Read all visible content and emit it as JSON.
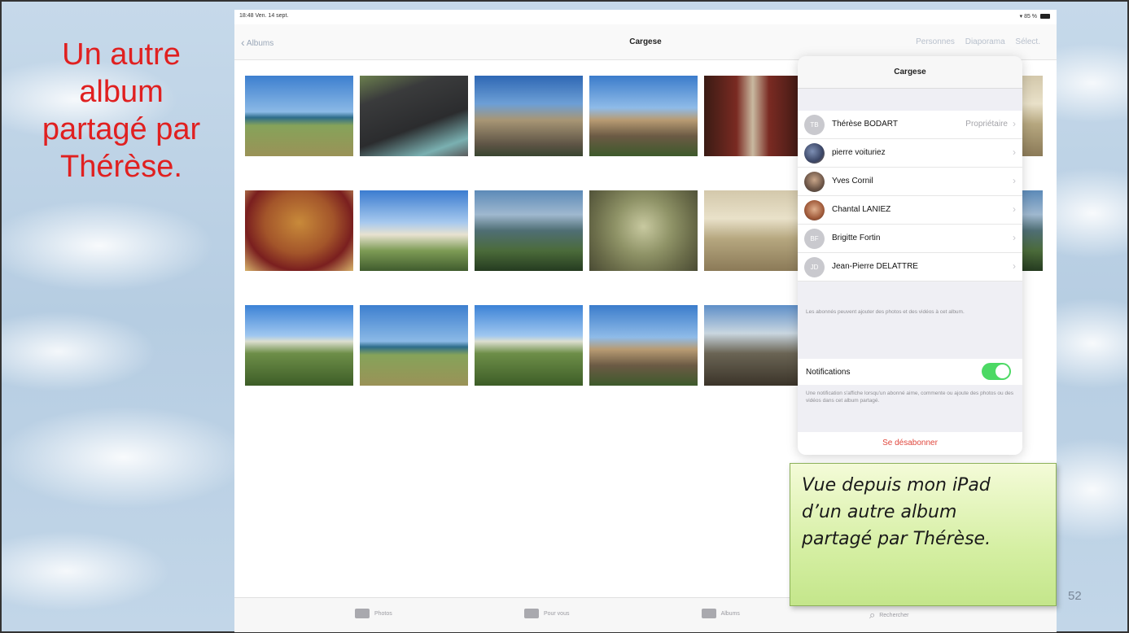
{
  "slide": {
    "title_lines": [
      "Un autre",
      "album",
      "partagé par",
      "Thérèse."
    ],
    "page_number": "52"
  },
  "status_bar": {
    "time_date": "18:48 Ven. 14 sept.",
    "battery": "85 %"
  },
  "nav": {
    "back_label": "Albums",
    "title": "Cargese",
    "people_label": "Personnes",
    "slideshow_label": "Diaporama",
    "select_label": "Sélect."
  },
  "photos": [
    {
      "icon": "photo-coast"
    },
    {
      "icon": "photo-plaque"
    },
    {
      "icon": "photo-church-tower"
    },
    {
      "icon": "photo-chapel"
    },
    {
      "icon": "photo-altar"
    },
    {
      "icon": "photo-fresco"
    },
    {
      "icon": "photo-village"
    },
    {
      "icon": "photo-harbor"
    },
    {
      "icon": "photo-dome"
    },
    {
      "icon": "photo-interior"
    },
    {
      "icon": "photo-hills"
    },
    {
      "icon": "photo-coast-2"
    },
    {
      "icon": "photo-hills-2"
    },
    {
      "icon": "photo-chapel-2"
    },
    {
      "icon": "photo-terrace"
    }
  ],
  "popover": {
    "title": "Cargese",
    "people": [
      {
        "initials": "TB",
        "name": "Thérèse BODART",
        "role": "Propriétaire"
      },
      {
        "initials": "",
        "name": "pierre voituriez",
        "role": ""
      },
      {
        "initials": "",
        "name": "Yves Cornil",
        "role": ""
      },
      {
        "initials": "",
        "name": "Chantal LANIEZ",
        "role": ""
      },
      {
        "initials": "BF",
        "name": "Brigitte Fortin",
        "role": ""
      },
      {
        "initials": "JD",
        "name": "Jean-Pierre DELATTRE",
        "role": ""
      }
    ],
    "subscribers_note": "Les abonnés peuvent ajouter des photos et des vidéos à cet album.",
    "notifications_label": "Notifications",
    "notifications_on": true,
    "notifications_note": "Une notification s'affiche lorsqu'un abonné aime, commente ou ajoute des photos ou des vidéos dans cet album partagé.",
    "unsubscribe_label": "Se désabonner",
    "colors": {
      "toggle": "#4cd964",
      "destructive": "#e0463c"
    }
  },
  "tab_bar": {
    "photos": "Photos",
    "for_you": "Pour vous",
    "albums": "Albums",
    "search": "Rechercher"
  },
  "callout": {
    "lines": [
      "Vue depuis mon iPad",
      "d’un autre album",
      "partagé par Thérèse."
    ]
  }
}
